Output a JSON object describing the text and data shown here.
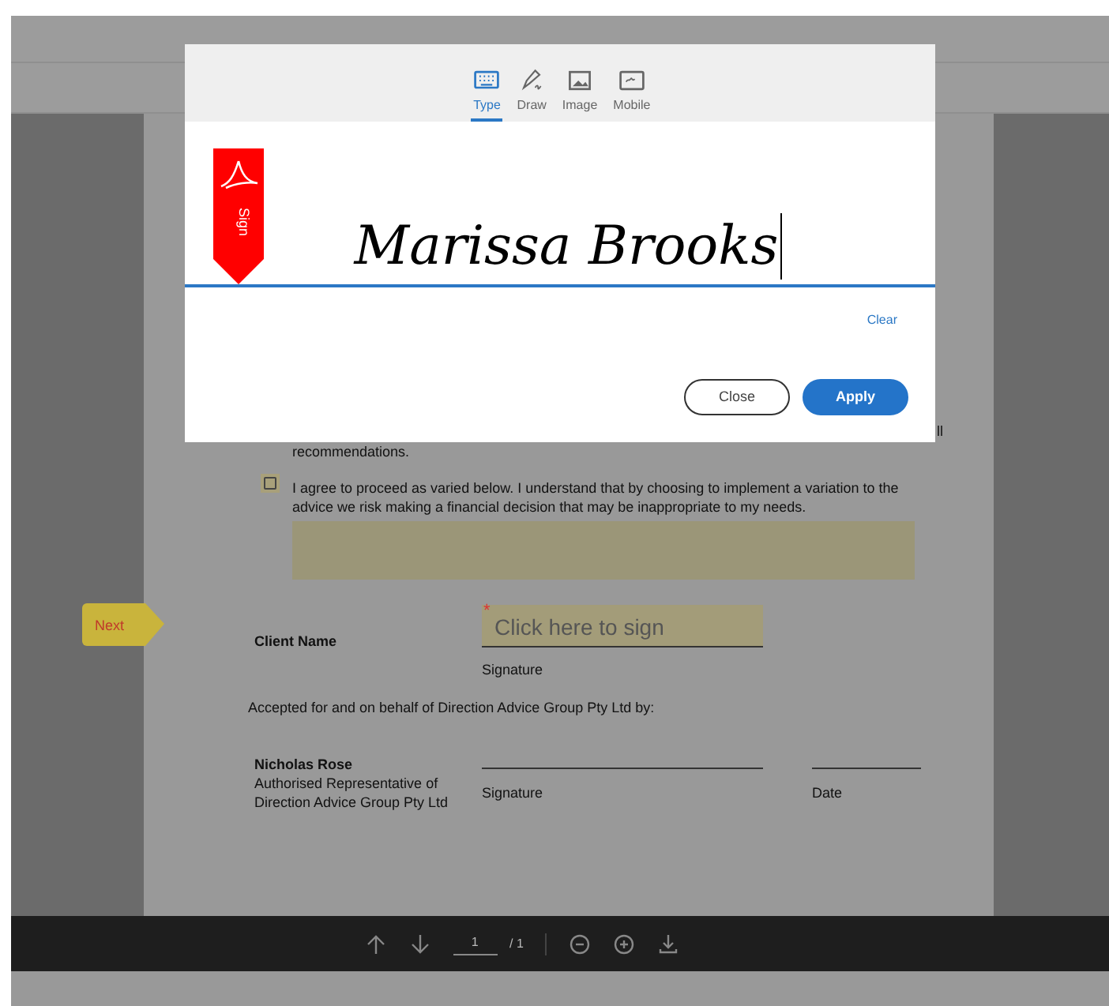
{
  "signature_dialog": {
    "tabs": [
      {
        "label": "Type",
        "kind": "keyboard",
        "selected": true
      },
      {
        "label": "Draw",
        "kind": "pen",
        "selected": false
      },
      {
        "label": "Image",
        "kind": "image",
        "selected": false
      },
      {
        "label": "Mobile",
        "kind": "mobile",
        "selected": false
      }
    ],
    "ribbon_label": "Sign",
    "typed_name": "Marissa Brooks",
    "clear_link": "Clear",
    "buttons": [
      {
        "label": "Close",
        "kind": "secondary"
      },
      {
        "label": "Apply",
        "kind": "primary"
      }
    ]
  },
  "document": {
    "cut_text": "ll",
    "recommendations_line": "recommendations.",
    "variation_option": {
      "checked": false,
      "text": "I agree to proceed as varied below. I understand that by choosing to implement a variation to the advice we risk making a financial decision that may be inappropriate to my needs."
    },
    "next_tag": "Next",
    "client_name_label": "Client Name",
    "sign_field": {
      "placeholder": "Click here to sign",
      "required_mark": "*"
    },
    "signature_caption": "Signature",
    "accepted_text": "Accepted for and on behalf of Direction Advice Group Pty Ltd by:",
    "representative": {
      "name": "Nicholas Rose",
      "title_lines": [
        "Authorised Representative of",
        "Direction Advice Group Pty Ltd"
      ]
    },
    "rep_signature_caption": "Signature",
    "date_caption": "Date"
  },
  "toolbar": {
    "page_number": "1",
    "page_total": "/ 1"
  }
}
